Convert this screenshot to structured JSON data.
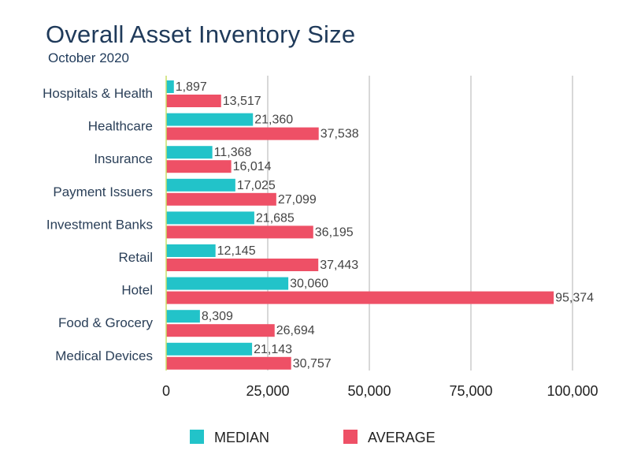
{
  "title": "Overall Asset Inventory Size",
  "subtitle": "October 2020",
  "colors": {
    "median": "#22c3c9",
    "average": "#ee5066",
    "grid": "#cccccc",
    "axis": "#c8df6a"
  },
  "chart_data": {
    "type": "bar",
    "orientation": "horizontal",
    "title": "Overall Asset Inventory Size",
    "subtitle": "October 2020",
    "categories": [
      "Hospitals & Health",
      "Healthcare",
      "Insurance",
      "Payment Issuers",
      "Investment Banks",
      "Retail",
      "Hotel",
      "Food & Grocery",
      "Medical Devices"
    ],
    "series": [
      {
        "name": "MEDIAN",
        "values": [
          1897,
          21360,
          11368,
          17025,
          21685,
          12145,
          30060,
          8309,
          21143
        ],
        "labels": [
          "1,897",
          "21,360",
          "11,368",
          "17,025",
          "21,685",
          "12,145",
          "30,060",
          "8,309",
          "21,143"
        ]
      },
      {
        "name": "AVERAGE",
        "values": [
          13517,
          37538,
          16014,
          27099,
          36195,
          37443,
          95374,
          26694,
          30757
        ],
        "labels": [
          "13,517",
          "37,538",
          "16,014",
          "27,099",
          "36,195",
          "37,443",
          "95,374",
          "26,694",
          "30,757"
        ]
      }
    ],
    "xlim": [
      0,
      100000
    ],
    "xticks": [
      0,
      25000,
      50000,
      75000,
      100000
    ],
    "xtick_labels": [
      "0",
      "25,000",
      "50,000",
      "75,000",
      "100,000"
    ],
    "xlabel": "",
    "ylabel": "",
    "grid": true,
    "legend": {
      "position": "bottom",
      "entries": [
        "MEDIAN",
        "AVERAGE"
      ]
    }
  }
}
